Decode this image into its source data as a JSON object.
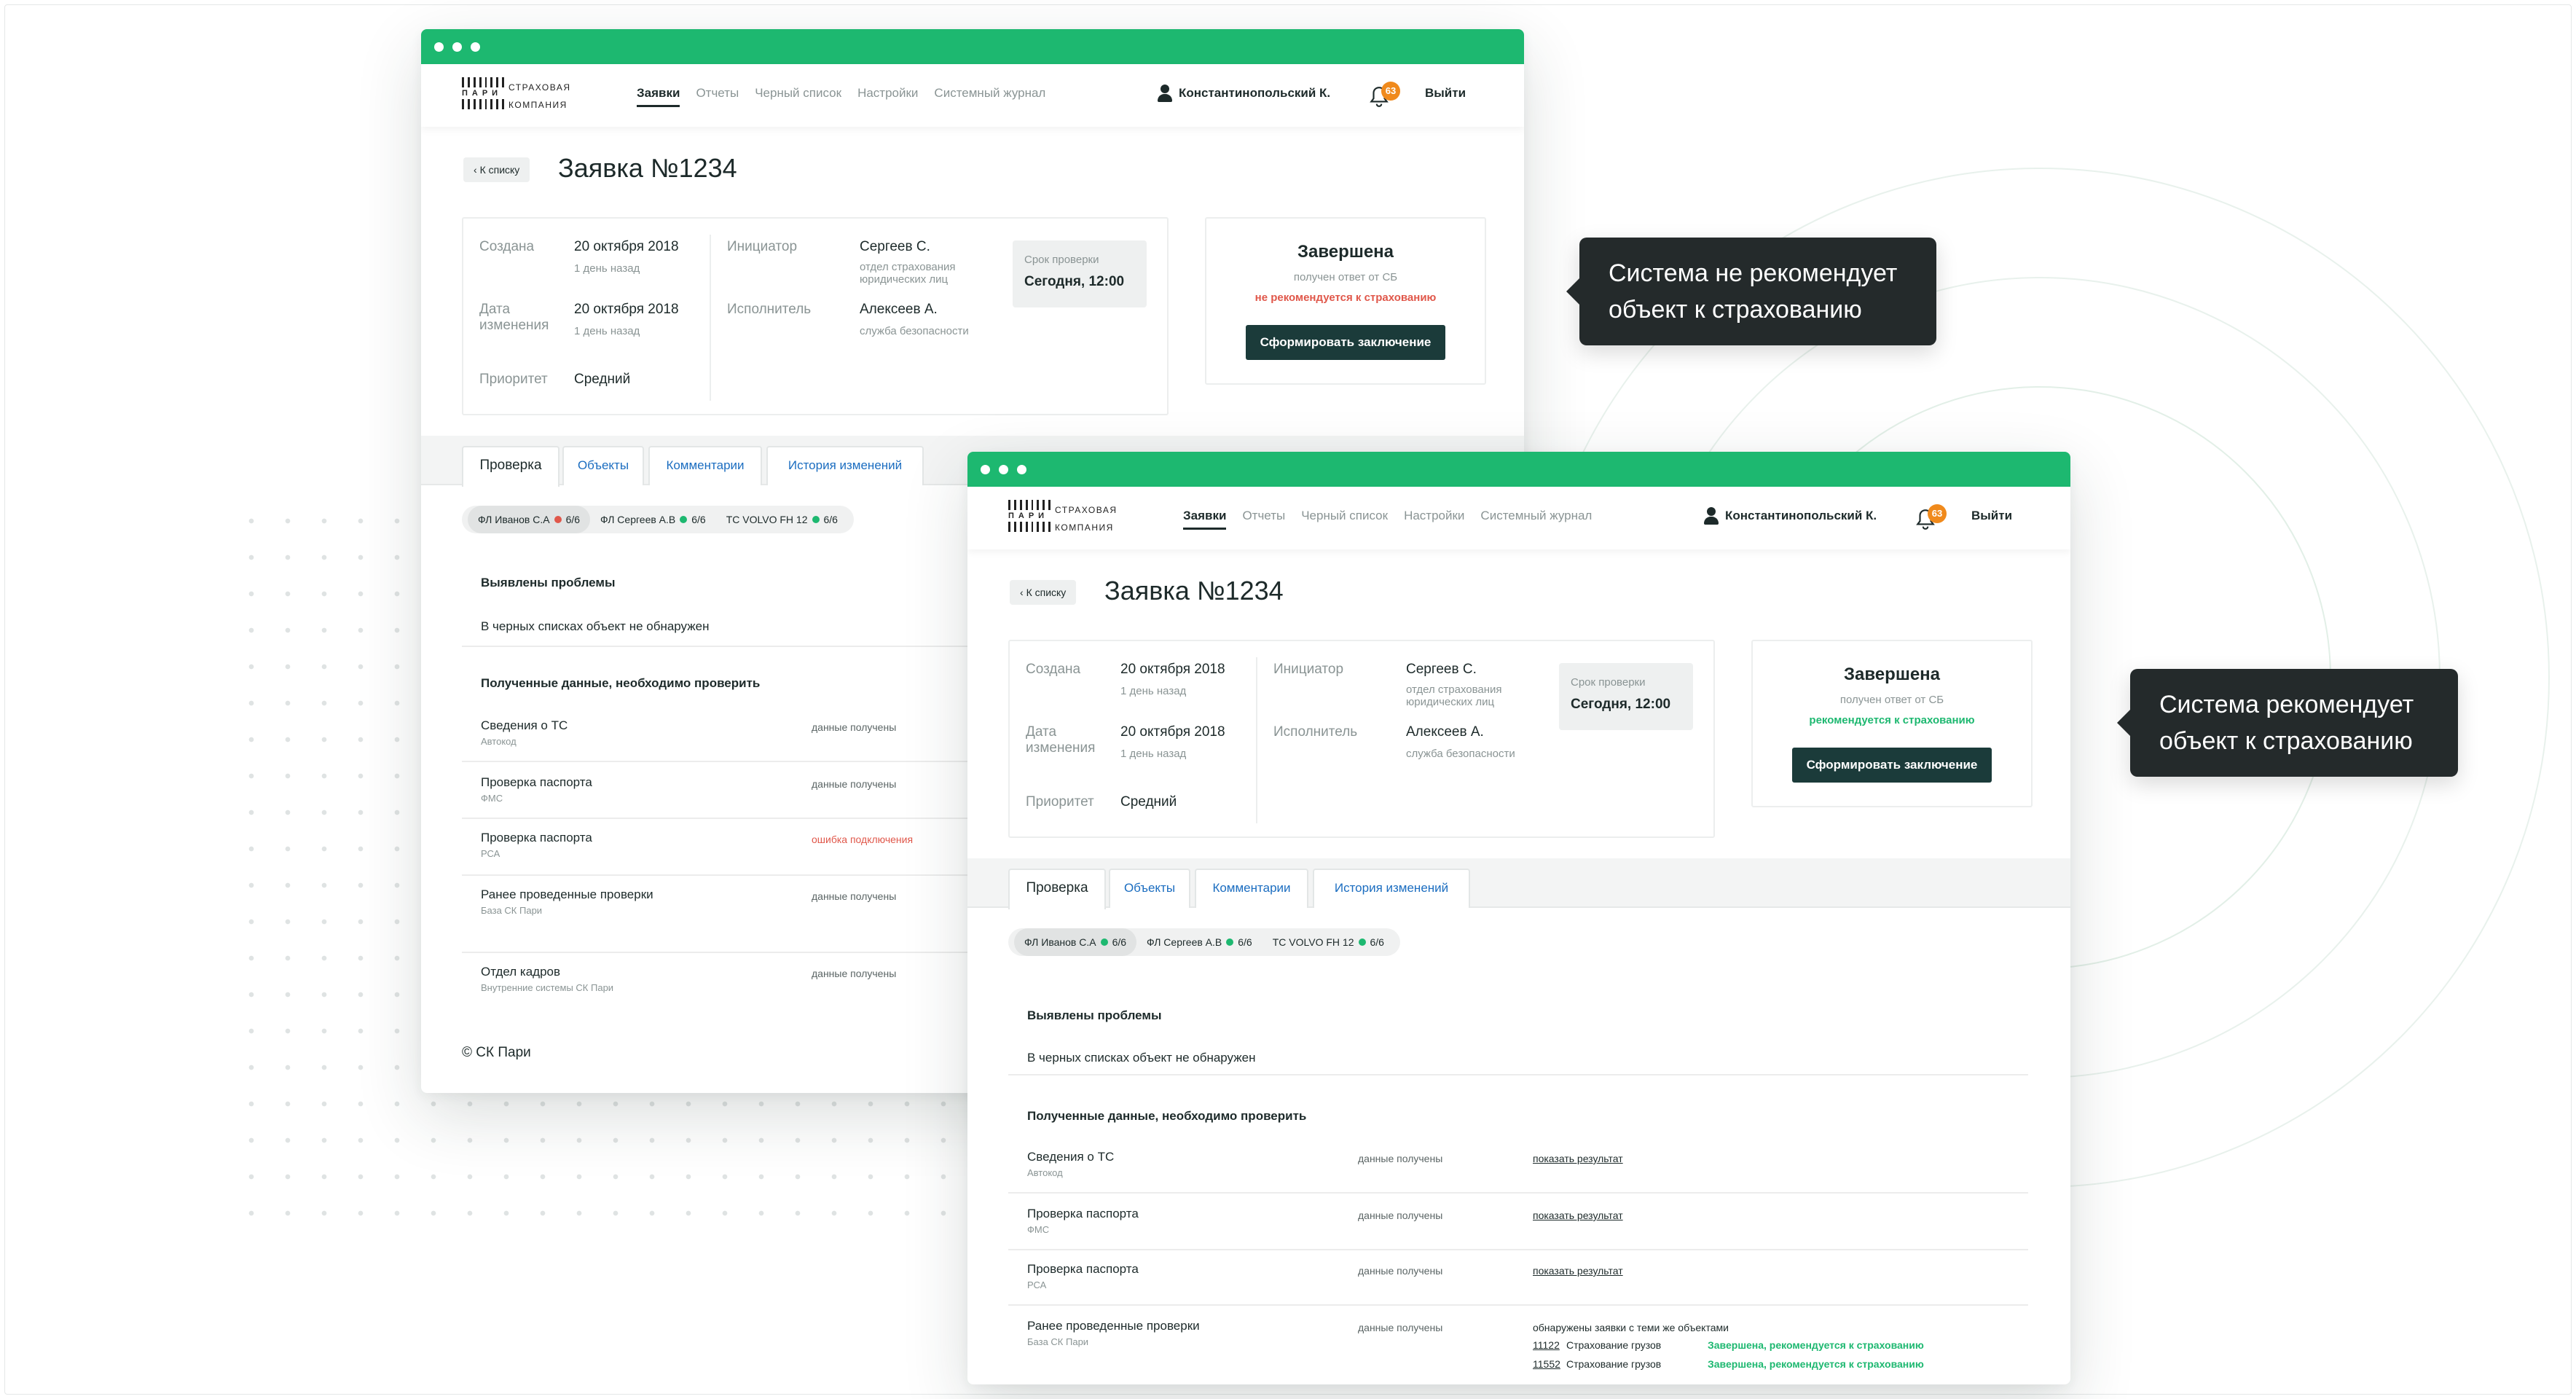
{
  "logo": {
    "mid": "ПАРИ",
    "line1": "СТРАХОВАЯ",
    "line2": "КОМПАНИЯ"
  },
  "nav": [
    "Заявки",
    "Отчеты",
    "Черный список",
    "Настройки",
    "Системный журнал"
  ],
  "user": {
    "name": "Константинопольский К.",
    "notifications": "63",
    "logout": "Выйти"
  },
  "request": {
    "back": "К списку",
    "title": "Заявка №1234",
    "created_label": "Создана",
    "created_value": "20 октября 2018",
    "created_ago": "1 день назад",
    "changed_label": "Дата изменения",
    "changed_value": "20 октября 2018",
    "changed_ago": "1 день назад",
    "priority_label": "Приоритет",
    "priority_value": "Средний",
    "initiator_label": "Инициатор",
    "initiator_value": "Сергеев С.",
    "initiator_dept": "отдел страхования юридических лиц",
    "executor_label": "Исполнитель",
    "executor_value": "Алексеев А.",
    "executor_dept": "служба безопасности",
    "deadline_label": "Срок проверки",
    "deadline_value": "Сегодня, 12:00"
  },
  "status": {
    "title": "Завершена",
    "sub": "получен ответ от СБ",
    "not_recommended": "не рекомендуется к страхованию",
    "recommended": "рекомендуется к страхованию",
    "button": "Сформировать заключение"
  },
  "tabs": [
    "Проверка",
    "Объекты",
    "Комментарии",
    "История изменений"
  ],
  "chips": [
    {
      "label": "ФЛ Иванов С.А",
      "count": "6/6"
    },
    {
      "label": "ФЛ Сергеев А.В",
      "count": "6/6"
    },
    {
      "label": "ТС VOLVO FH 12",
      "count": "6/6"
    }
  ],
  "problems": {
    "title": "Выявлены проблемы",
    "text": "В черных списках объект не обнаружен"
  },
  "checks_title": "Полученные данные, необходимо проверить",
  "checks_a": [
    {
      "name": "Сведения о ТС",
      "source": "Автокод",
      "status": "данные получены"
    },
    {
      "name": "Проверка паспорта",
      "source": "ФМС",
      "status": "данные получены"
    },
    {
      "name": "Проверка паспорта",
      "source": "РСА",
      "status": "ошибка подключения"
    },
    {
      "name": "Ранее проведенные проверки",
      "source": "База СК Пари",
      "status": "данные получены"
    },
    {
      "name": "Отдел кадров",
      "source": "Внутренние системы СК Пари",
      "status": "данные получены"
    }
  ],
  "checks_b": [
    {
      "name": "Сведения о ТС",
      "source": "Автокод",
      "status": "данные получены",
      "link": "показать результат"
    },
    {
      "name": "Проверка паспорта",
      "source": "ФМС",
      "status": "данные получены",
      "link": "показать результат"
    },
    {
      "name": "Проверка паспорта",
      "source": "РСА",
      "status": "данные получены",
      "link": "показать результат"
    },
    {
      "name": "Ранее проведенные проверки",
      "source": "База СК Пари",
      "status": "данные получены",
      "link": ""
    }
  ],
  "matches": {
    "intro": "обнаружены заявки с теми же объектами",
    "items": [
      {
        "id": "11122",
        "type": "Страхование грузов",
        "status": "Завершена, рекомендуется к страхованию"
      },
      {
        "id": "11552",
        "type": "Страхование грузов",
        "status": "Завершена, рекомендуется к страхованию"
      }
    ]
  },
  "footer": "© СК Пари",
  "callouts": {
    "not_recommend": "Система не рекомендует объект к страхованию",
    "recommend": "Система рекомендует объект к страхованию"
  },
  "colors": {
    "accent": "#1db870",
    "dark_button": "#1b3b3a",
    "error": "#e0574a",
    "badge": "#f08a1c",
    "link": "#1b6dc0"
  }
}
